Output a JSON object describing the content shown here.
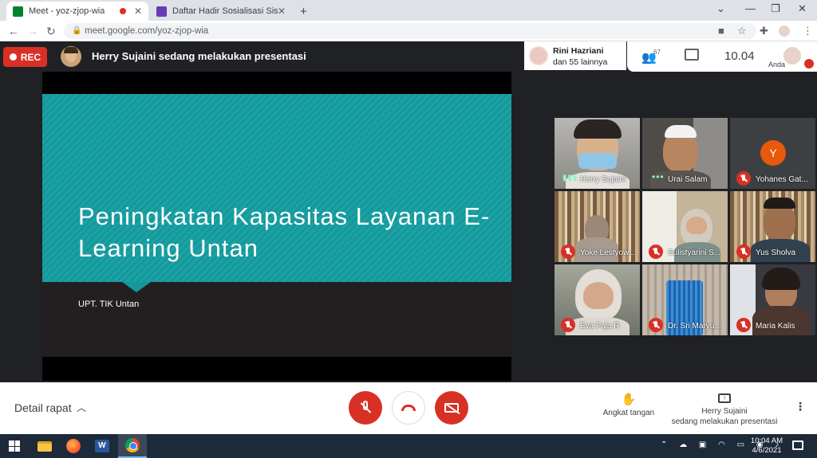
{
  "browser": {
    "tabs": [
      {
        "title": "Meet - yoz-zjop-wia",
        "active": true,
        "recording": true
      },
      {
        "title": "Daftar Hadir Sosialisasi Sistem E-L",
        "active": false
      }
    ],
    "new_tab": "+",
    "url": "meet.google.com/yoz-zjop-wia"
  },
  "meet": {
    "rec_label": "REC",
    "presenting": "Herry Sujaini sedang melakukan presentasi",
    "participants_chip": {
      "line1": "Rini Hazriani",
      "line2": "dan 55 lainnya"
    },
    "people_count": "67",
    "clock": "10.04",
    "self_label": "Anda"
  },
  "slide": {
    "title": "Peningkatan Kapasitas Layanan E-Learning Untan",
    "subtitle": "UPT. TIK Untan",
    "colors": {
      "band": "#1aa3a6",
      "bottom": "#231f20"
    }
  },
  "tiles": [
    {
      "name": "Herry Sujaini",
      "status": "speaking"
    },
    {
      "name": "Urai Salam",
      "status": "active"
    },
    {
      "name": "Yohanes Gat...",
      "status": "muted",
      "initial": "Y"
    },
    {
      "name": "Yoke Lestyow...",
      "status": "muted"
    },
    {
      "name": "Sulistyarini S...",
      "status": "muted"
    },
    {
      "name": "Yus Sholva",
      "status": "muted"
    },
    {
      "name": "Eva Faja R",
      "status": "muted"
    },
    {
      "name": "Dr. Sri Maryu...",
      "status": "muted"
    },
    {
      "name": "Maria Kalis",
      "status": "muted"
    }
  ],
  "controls": {
    "meeting_details": "Detail rapat",
    "raise_hand": "Angkat tangan",
    "presenting_line1": "Herry Sujaini",
    "presenting_line2": "sedang melakukan presentasi"
  },
  "taskbar": {
    "time": "10:04 AM",
    "date": "4/6/2021"
  },
  "icons": [
    "windows-icon",
    "file-explorer-icon",
    "firefox-icon",
    "word-icon",
    "chrome-icon"
  ]
}
